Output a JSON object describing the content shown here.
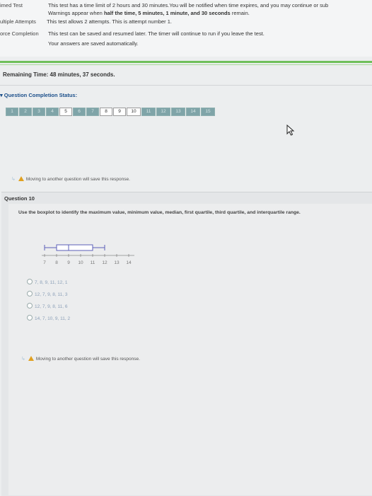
{
  "info": {
    "timed_label": "imed Test",
    "timed_line1": "This test has a time limit of 2 hours and 30 minutes.You will be notified when time expires, and you may continue or sub",
    "timed_line2_pre": "Warnings appear when ",
    "timed_line2_bold": "half the time, 5 minutes, 1 minute, and 30 seconds",
    "timed_line2_post": " remain.",
    "attempts_label": "ultiple Attempts",
    "attempts_text": "This test allows 2 attempts. This is attempt number 1.",
    "completion_label": "orce Completion",
    "completion_text": "This test can be saved and resumed later. The timer will continue to run if you leave the test.",
    "autosave_text": "Your answers are saved automatically."
  },
  "remaining_time": "Remaining Time: 48 minutes, 37 seconds.",
  "status_title": "Question Completion Status:",
  "questions": [
    {
      "label": "1",
      "state": "answered"
    },
    {
      "label": "2",
      "state": "answered"
    },
    {
      "label": "3",
      "state": "answered"
    },
    {
      "label": "4",
      "state": "answered"
    },
    {
      "label": "5",
      "state": "unanswered"
    },
    {
      "label": "6",
      "state": "answered"
    },
    {
      "label": "7",
      "state": "answered"
    },
    {
      "label": "8",
      "state": "unanswered"
    },
    {
      "label": "9",
      "state": "unanswered"
    },
    {
      "label": "10",
      "state": "unanswered"
    },
    {
      "label": "11",
      "state": "answered"
    },
    {
      "label": "12",
      "state": "answered"
    },
    {
      "label": "13",
      "state": "answered"
    },
    {
      "label": "14",
      "state": "answered"
    },
    {
      "label": "15",
      "state": "answered"
    }
  ],
  "save_notice": "Moving to another question will save this response.",
  "question": {
    "header": "Question 10",
    "prompt": "Use the boxplot to identify the maximum value, minimum value, median, first quartile, third quartile, and interquartile range.",
    "axis_ticks": [
      "7",
      "8",
      "9",
      "10",
      "11",
      "12",
      "13",
      "14"
    ],
    "boxplot": {
      "min": 7,
      "q1": 8,
      "median": 9,
      "q3": 11,
      "max": 12
    },
    "options": [
      "7, 8, 9, 11, 12, 1",
      "12, 7, 9, 8, 11, 3",
      "12, 7, 9, 8, 11, 6",
      "14, 7, 10, 9, 11, 2"
    ]
  },
  "colors": {
    "accent_green": "#6fbf5a",
    "answered_box": "#7fa4a8",
    "link_blue": "#1b4f8a",
    "warning": "#e0a020"
  }
}
